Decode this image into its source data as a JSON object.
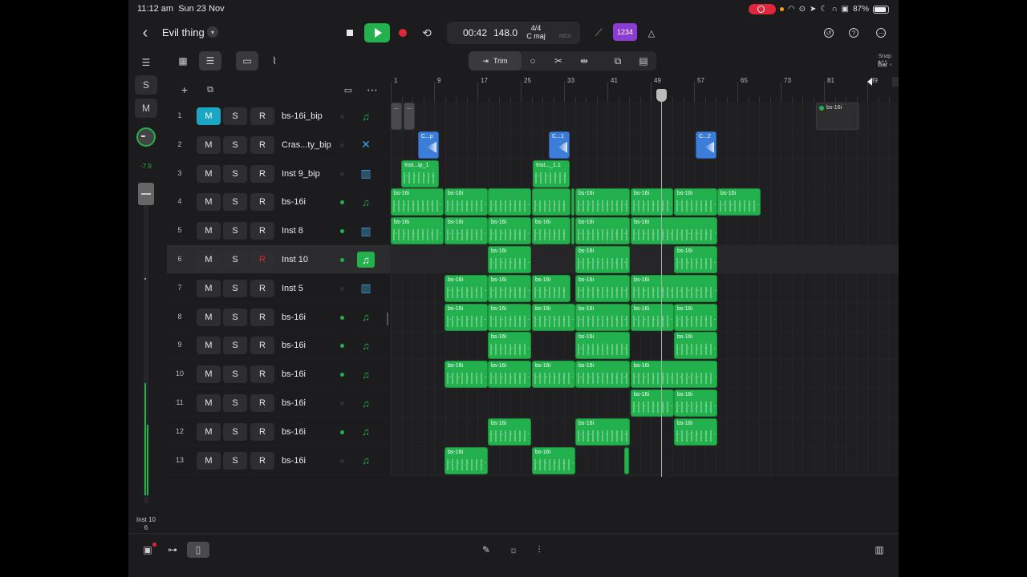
{
  "status": {
    "time": "11:12 am",
    "date": "Sun 23 Nov",
    "battery": "87%"
  },
  "header": {
    "title": "Evil thing",
    "lcd_time": "00:42",
    "lcd_tempo": "148.0",
    "lcd_sig_top": "4/4",
    "lcd_key": "C maj",
    "lcd_midi": "MIDI",
    "count_in": "1234"
  },
  "leftstrip": {
    "solo_label": "S",
    "mute_label": "M",
    "volume_value": "-7.9",
    "track_name": "Inst 10",
    "track_index": "6"
  },
  "toolbar": {
    "trim_label": "Trim",
    "snap_label": "Snap",
    "snap_value": "Bar ◦"
  },
  "track_buttons": {
    "mute": "M",
    "solo": "S",
    "rec": "R"
  },
  "tracks": [
    {
      "num": "1",
      "name": "bs-16i_bip"
    },
    {
      "num": "2",
      "name": "Cras...ty_bip"
    },
    {
      "num": "3",
      "name": "Inst 9_bip"
    },
    {
      "num": "4",
      "name": "bs-16i"
    },
    {
      "num": "5",
      "name": "Inst 8"
    },
    {
      "num": "6",
      "name": "Inst 10"
    },
    {
      "num": "7",
      "name": "Inst 5"
    },
    {
      "num": "8",
      "name": "bs-16i"
    },
    {
      "num": "9",
      "name": "bs-16i"
    },
    {
      "num": "10",
      "name": "bs-16i"
    },
    {
      "num": "11",
      "name": "bs-16i"
    },
    {
      "num": "12",
      "name": "bs-16i"
    },
    {
      "num": "13",
      "name": "bs-16i"
    }
  ],
  "ruler": {
    "bars": [
      "1",
      "9",
      "17",
      "25",
      "33",
      "41",
      "49",
      "57",
      "65",
      "73",
      "81",
      "89"
    ]
  },
  "regions": {
    "r1a": "...",
    "r1b": "...",
    "r1c": "bs-16i",
    "r2a": "C...p",
    "r2b": "C...1",
    "r2c": "C...2",
    "r3a": "Inst...ip_1",
    "r3b": "Inst..._1.1",
    "bs": "bs-16i"
  }
}
